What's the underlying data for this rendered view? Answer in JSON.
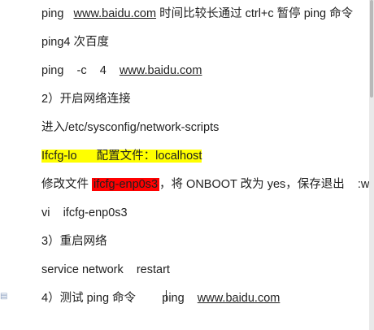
{
  "lines": [
    {
      "pre": "ping   ",
      "url": "www.baidu.com",
      "post": " 时间比较长通过 ctrl+c 暂停 ping 命令"
    },
    {
      "text": "ping4 次百度"
    },
    {
      "pre": "ping    -c    4    ",
      "url": "www.baidu.com"
    },
    {
      "text": "2）开启网络连接"
    },
    {
      "text": "进入/etc/sysconfig/network-scripts"
    },
    {
      "hl": "Ifcfg-lo      配置文件：localhost"
    },
    {
      "pre": "修改文件 ",
      "hl": "ifcfg-enp0s3",
      "post": "，将 ONBOOT 改为 yes，保存退出    :wq"
    },
    {
      "text": "vi    ifcfg-enp0s3"
    },
    {
      "text": "3）重启网络"
    },
    {
      "text": "service network    restart"
    },
    {
      "pre": "4）测试 ping 命令        ping    ",
      "url": "www.baidu.com"
    }
  ],
  "icons": {
    "side": "document-icon"
  }
}
